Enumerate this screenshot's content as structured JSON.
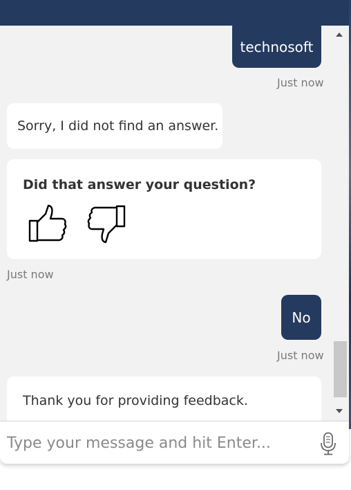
{
  "messages": {
    "user_1": "technosoft",
    "user_1_time": "Just now",
    "bot_1": "Sorry, I did not find an answer.",
    "feedback_question": "Did that answer your question?",
    "feedback_time": "Just now",
    "user_2": "No",
    "user_2_time": "Just now",
    "bot_2": "Thank you for providing feedback."
  },
  "input": {
    "placeholder": "Type your message and hit Enter..."
  },
  "icons": {
    "thumbs_up": "thumbs-up-icon",
    "thumbs_down": "thumbs-down-icon",
    "microphone": "microphone-icon"
  },
  "colors": {
    "accent": "#243a5e",
    "chat_background": "#f2f2f2"
  }
}
